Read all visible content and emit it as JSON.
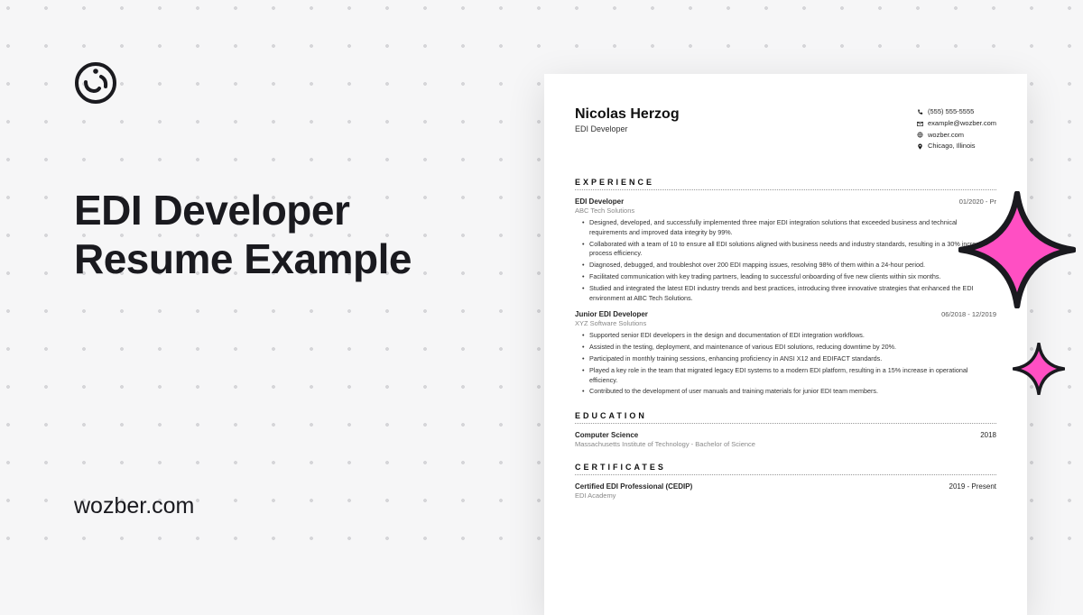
{
  "page": {
    "title_line1": "EDI Developer",
    "title_line2": "Resume Example",
    "site": "wozber.com"
  },
  "resume": {
    "name": "Nicolas Herzog",
    "role": "EDI Developer",
    "contacts": {
      "phone": "(555) 555-5555",
      "email": "example@wozber.com",
      "web": "wozber.com",
      "location": "Chicago, Illinois"
    },
    "sections": {
      "experience": "EXPERIENCE",
      "education": "EDUCATION",
      "certificates": "CERTIFICATES"
    },
    "jobs": [
      {
        "title": "EDI Developer",
        "date": "01/2020 - Pr",
        "company": "ABC Tech Solutions",
        "bullets": [
          "Designed, developed, and successfully implemented three major EDI integration solutions that exceeded business and technical requirements and improved data integrity by 99%.",
          "Collaborated with a team of 10 to ensure all EDI solutions aligned with business needs and industry standards, resulting in a 30% increase in process efficiency.",
          "Diagnosed, debugged, and troubleshot over 200 EDI mapping issues, resolving 98% of them within a 24-hour period.",
          "Facilitated communication with key trading partners, leading to successful onboarding of five new clients within six months.",
          "Studied and integrated the latest EDI industry trends and best practices, introducing three innovative strategies that enhanced the EDI environment at ABC Tech Solutions."
        ]
      },
      {
        "title": "Junior EDI Developer",
        "date": "06/2018 - 12/2019",
        "company": "XYZ Software Solutions",
        "bullets": [
          "Supported senior EDI developers in the design and documentation of EDI integration workflows.",
          "Assisted in the testing, deployment, and maintenance of various EDI solutions, reducing downtime by 20%.",
          "Participated in monthly training sessions, enhancing proficiency in ANSI X12 and EDIFACT standards.",
          "Played a key role in the team that migrated legacy EDI systems to a modern EDI platform, resulting in a 15% increase in operational efficiency.",
          "Contributed to the development of user manuals and training materials for junior EDI team members."
        ]
      }
    ],
    "education": {
      "title": "Computer Science",
      "year": "2018",
      "sub": "Massachusetts Institute of Technology - Bachelor of Science"
    },
    "certificate": {
      "title": "Certified EDI Professional (CEDIP)",
      "date": "2019 - Present",
      "sub": "EDI Academy"
    }
  }
}
